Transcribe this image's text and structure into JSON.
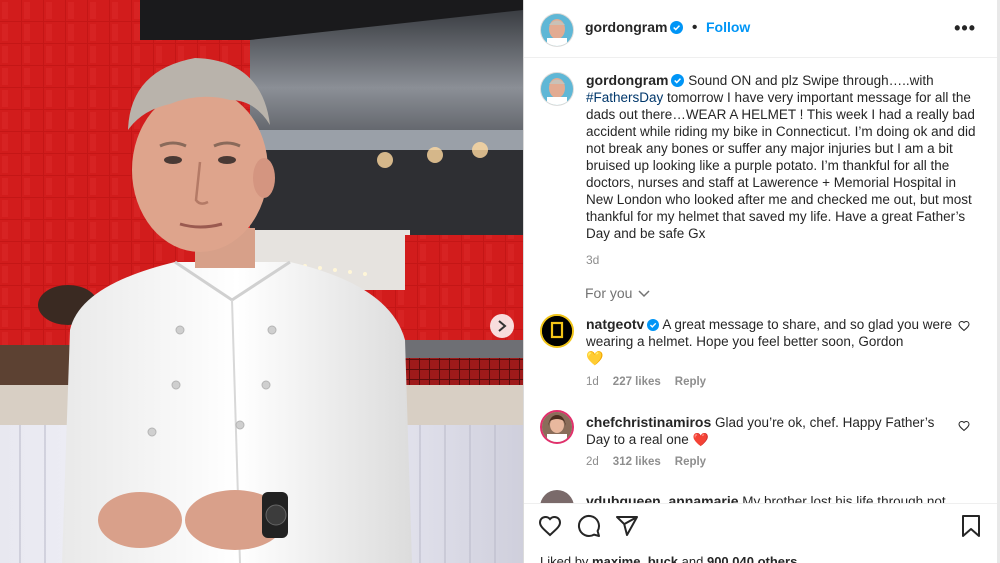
{
  "post": {
    "username": "gordongram",
    "follow_label": "Follow",
    "more_label": "•••",
    "caption_lead": "Sound ON and plz Swipe through…..with",
    "hashtag": "#FathersDay",
    "caption_rest": " tomorrow I have very important message for all the dads out there…WEAR A HELMET ! This week I had a really bad accident while riding my bike in Connecticut. I’m doing ok and did not break any bones or suffer any major injuries but I am a bit bruised up looking like a purple potato. I’m thankful for all the doctors, nurses and staff at Lawerence + Memorial Hospital in New London who looked after me and checked me out, but most thankful for my helmet that saved my life. Have a great Father’s Day and be safe Gx",
    "age": "3d",
    "for_you": "For you"
  },
  "comments": [
    {
      "username": "natgeotv",
      "text": "A great message to share, and so glad you were wearing a helmet. Hope you feel better soon, Gordon",
      "emoji": "💛",
      "age": "1d",
      "likes": "227 likes",
      "reply": "Reply"
    },
    {
      "username": "chefchristinamiros",
      "text": "Glad you’re ok, chef. Happy Father’s Day to a real one",
      "emoji": "❤️",
      "age": "2d",
      "likes": "312 likes",
      "reply": "Reply"
    },
    {
      "username": "vdubqueen_annamarie",
      "text": "My brother lost his life through not"
    }
  ],
  "footer": {
    "liked_prefix": "Liked by ",
    "liked_user": "maxime_buck",
    "liked_middle": " and ",
    "liked_count": "900,040 others"
  },
  "colors": {
    "accent": "#0095f6",
    "verified": "#0095f6",
    "heart": "#ed4956",
    "yellow_heart": "#f5c518"
  },
  "icons": [
    "heart-icon",
    "comment-icon",
    "share-icon",
    "bookmark-icon",
    "verified-icon",
    "chevron-down-icon",
    "next-arrow-icon"
  ]
}
